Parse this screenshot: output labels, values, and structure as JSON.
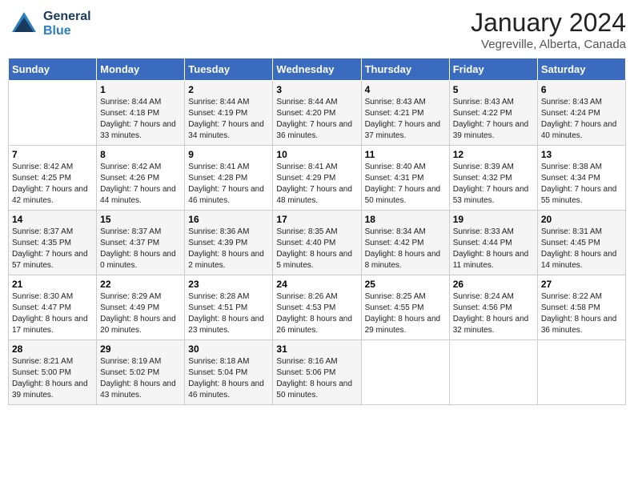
{
  "header": {
    "logo_general": "General",
    "logo_blue": "Blue",
    "title": "January 2024",
    "subtitle": "Vegreville, Alberta, Canada"
  },
  "days_of_week": [
    "Sunday",
    "Monday",
    "Tuesday",
    "Wednesday",
    "Thursday",
    "Friday",
    "Saturday"
  ],
  "weeks": [
    [
      {
        "day": "",
        "sunrise": "",
        "sunset": "",
        "daylight": ""
      },
      {
        "day": "1",
        "sunrise": "Sunrise: 8:44 AM",
        "sunset": "Sunset: 4:18 PM",
        "daylight": "Daylight: 7 hours and 33 minutes."
      },
      {
        "day": "2",
        "sunrise": "Sunrise: 8:44 AM",
        "sunset": "Sunset: 4:19 PM",
        "daylight": "Daylight: 7 hours and 34 minutes."
      },
      {
        "day": "3",
        "sunrise": "Sunrise: 8:44 AM",
        "sunset": "Sunset: 4:20 PM",
        "daylight": "Daylight: 7 hours and 36 minutes."
      },
      {
        "day": "4",
        "sunrise": "Sunrise: 8:43 AM",
        "sunset": "Sunset: 4:21 PM",
        "daylight": "Daylight: 7 hours and 37 minutes."
      },
      {
        "day": "5",
        "sunrise": "Sunrise: 8:43 AM",
        "sunset": "Sunset: 4:22 PM",
        "daylight": "Daylight: 7 hours and 39 minutes."
      },
      {
        "day": "6",
        "sunrise": "Sunrise: 8:43 AM",
        "sunset": "Sunset: 4:24 PM",
        "daylight": "Daylight: 7 hours and 40 minutes."
      }
    ],
    [
      {
        "day": "7",
        "sunrise": "Sunrise: 8:42 AM",
        "sunset": "Sunset: 4:25 PM",
        "daylight": "Daylight: 7 hours and 42 minutes."
      },
      {
        "day": "8",
        "sunrise": "Sunrise: 8:42 AM",
        "sunset": "Sunset: 4:26 PM",
        "daylight": "Daylight: 7 hours and 44 minutes."
      },
      {
        "day": "9",
        "sunrise": "Sunrise: 8:41 AM",
        "sunset": "Sunset: 4:28 PM",
        "daylight": "Daylight: 7 hours and 46 minutes."
      },
      {
        "day": "10",
        "sunrise": "Sunrise: 8:41 AM",
        "sunset": "Sunset: 4:29 PM",
        "daylight": "Daylight: 7 hours and 48 minutes."
      },
      {
        "day": "11",
        "sunrise": "Sunrise: 8:40 AM",
        "sunset": "Sunset: 4:31 PM",
        "daylight": "Daylight: 7 hours and 50 minutes."
      },
      {
        "day": "12",
        "sunrise": "Sunrise: 8:39 AM",
        "sunset": "Sunset: 4:32 PM",
        "daylight": "Daylight: 7 hours and 53 minutes."
      },
      {
        "day": "13",
        "sunrise": "Sunrise: 8:38 AM",
        "sunset": "Sunset: 4:34 PM",
        "daylight": "Daylight: 7 hours and 55 minutes."
      }
    ],
    [
      {
        "day": "14",
        "sunrise": "Sunrise: 8:37 AM",
        "sunset": "Sunset: 4:35 PM",
        "daylight": "Daylight: 7 hours and 57 minutes."
      },
      {
        "day": "15",
        "sunrise": "Sunrise: 8:37 AM",
        "sunset": "Sunset: 4:37 PM",
        "daylight": "Daylight: 8 hours and 0 minutes."
      },
      {
        "day": "16",
        "sunrise": "Sunrise: 8:36 AM",
        "sunset": "Sunset: 4:39 PM",
        "daylight": "Daylight: 8 hours and 2 minutes."
      },
      {
        "day": "17",
        "sunrise": "Sunrise: 8:35 AM",
        "sunset": "Sunset: 4:40 PM",
        "daylight": "Daylight: 8 hours and 5 minutes."
      },
      {
        "day": "18",
        "sunrise": "Sunrise: 8:34 AM",
        "sunset": "Sunset: 4:42 PM",
        "daylight": "Daylight: 8 hours and 8 minutes."
      },
      {
        "day": "19",
        "sunrise": "Sunrise: 8:33 AM",
        "sunset": "Sunset: 4:44 PM",
        "daylight": "Daylight: 8 hours and 11 minutes."
      },
      {
        "day": "20",
        "sunrise": "Sunrise: 8:31 AM",
        "sunset": "Sunset: 4:45 PM",
        "daylight": "Daylight: 8 hours and 14 minutes."
      }
    ],
    [
      {
        "day": "21",
        "sunrise": "Sunrise: 8:30 AM",
        "sunset": "Sunset: 4:47 PM",
        "daylight": "Daylight: 8 hours and 17 minutes."
      },
      {
        "day": "22",
        "sunrise": "Sunrise: 8:29 AM",
        "sunset": "Sunset: 4:49 PM",
        "daylight": "Daylight: 8 hours and 20 minutes."
      },
      {
        "day": "23",
        "sunrise": "Sunrise: 8:28 AM",
        "sunset": "Sunset: 4:51 PM",
        "daylight": "Daylight: 8 hours and 23 minutes."
      },
      {
        "day": "24",
        "sunrise": "Sunrise: 8:26 AM",
        "sunset": "Sunset: 4:53 PM",
        "daylight": "Daylight: 8 hours and 26 minutes."
      },
      {
        "day": "25",
        "sunrise": "Sunrise: 8:25 AM",
        "sunset": "Sunset: 4:55 PM",
        "daylight": "Daylight: 8 hours and 29 minutes."
      },
      {
        "day": "26",
        "sunrise": "Sunrise: 8:24 AM",
        "sunset": "Sunset: 4:56 PM",
        "daylight": "Daylight: 8 hours and 32 minutes."
      },
      {
        "day": "27",
        "sunrise": "Sunrise: 8:22 AM",
        "sunset": "Sunset: 4:58 PM",
        "daylight": "Daylight: 8 hours and 36 minutes."
      }
    ],
    [
      {
        "day": "28",
        "sunrise": "Sunrise: 8:21 AM",
        "sunset": "Sunset: 5:00 PM",
        "daylight": "Daylight: 8 hours and 39 minutes."
      },
      {
        "day": "29",
        "sunrise": "Sunrise: 8:19 AM",
        "sunset": "Sunset: 5:02 PM",
        "daylight": "Daylight: 8 hours and 43 minutes."
      },
      {
        "day": "30",
        "sunrise": "Sunrise: 8:18 AM",
        "sunset": "Sunset: 5:04 PM",
        "daylight": "Daylight: 8 hours and 46 minutes."
      },
      {
        "day": "31",
        "sunrise": "Sunrise: 8:16 AM",
        "sunset": "Sunset: 5:06 PM",
        "daylight": "Daylight: 8 hours and 50 minutes."
      },
      {
        "day": "",
        "sunrise": "",
        "sunset": "",
        "daylight": ""
      },
      {
        "day": "",
        "sunrise": "",
        "sunset": "",
        "daylight": ""
      },
      {
        "day": "",
        "sunrise": "",
        "sunset": "",
        "daylight": ""
      }
    ]
  ]
}
